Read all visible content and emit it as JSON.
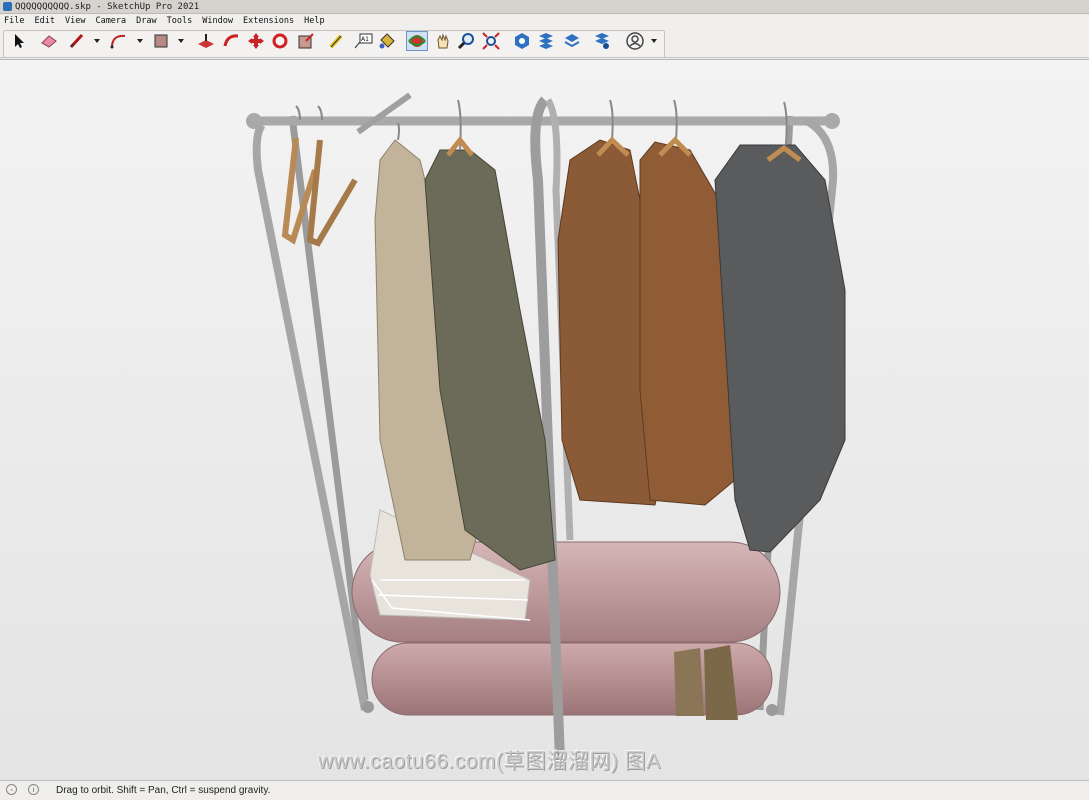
{
  "window": {
    "title": "QQQQQQQQQQ.skp - SketchUp Pro 2021"
  },
  "menu": [
    "File",
    "Edit",
    "View",
    "Camera",
    "Draw",
    "Tools",
    "Window",
    "Extensions",
    "Help"
  ],
  "toolbar": {
    "tools": [
      {
        "name": "select-tool-icon"
      },
      {
        "name": "eraser-tool-icon"
      },
      {
        "name": "line-tool-icon"
      },
      {
        "name": "arc-tool-icon"
      },
      {
        "name": "rectangle-tool-icon"
      },
      {
        "name": "push-pull-tool-icon"
      },
      {
        "name": "follow-me-tool-icon"
      },
      {
        "name": "move-tool-icon"
      },
      {
        "name": "rotate-tool-icon"
      },
      {
        "name": "scale-tool-icon"
      },
      {
        "name": "tape-measure-tool-icon"
      },
      {
        "name": "text-tool-icon",
        "label": "A1"
      },
      {
        "name": "paint-bucket-tool-icon"
      },
      {
        "name": "orbit-tool-icon"
      },
      {
        "name": "pan-tool-icon"
      },
      {
        "name": "zoom-tool-icon"
      },
      {
        "name": "zoom-extents-tool-icon"
      },
      {
        "name": "3d-warehouse-icon"
      },
      {
        "name": "extension-warehouse-icon"
      },
      {
        "name": "layout-send-icon"
      },
      {
        "name": "extension-manager-icon"
      },
      {
        "name": "account-icon"
      }
    ]
  },
  "status": {
    "text": "Drag to orbit. Shift = Pan, Ctrl = suspend gravity."
  },
  "watermark": {
    "text": "www.caotu66.com(草图溜溜网) 图A"
  },
  "colors": {
    "rack_metal": "#a9a9a9",
    "shelf_pink": "#c7a2a3",
    "coat_beige": "#c2b49a",
    "coat_olive": "#6c6a58",
    "coat_brown": "#8b5a36",
    "coat_gray": "#5a5b5c",
    "hanger_wood": "#b88a55"
  }
}
